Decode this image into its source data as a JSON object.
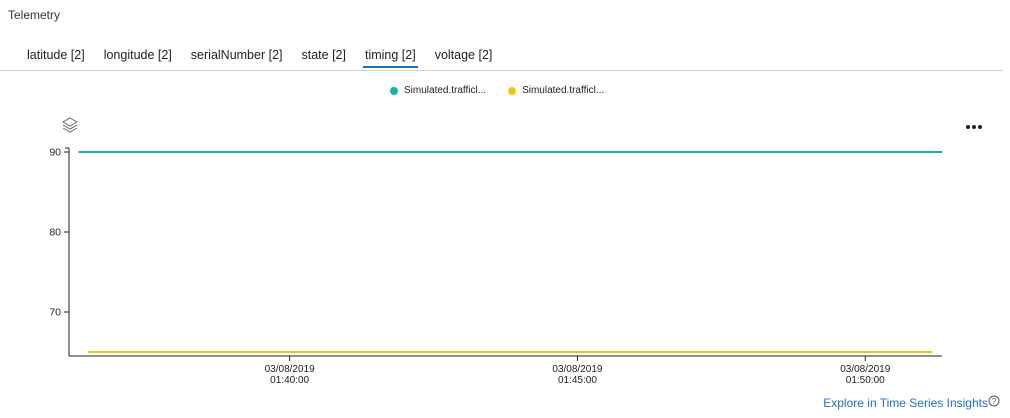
{
  "panel": {
    "title": "Telemetry"
  },
  "tabs": [
    {
      "label": "latitude [2]",
      "active": false
    },
    {
      "label": "longitude [2]",
      "active": false
    },
    {
      "label": "serialNumber [2]",
      "active": false
    },
    {
      "label": "state [2]",
      "active": false
    },
    {
      "label": "timing [2]",
      "active": true
    },
    {
      "label": "voltage [2]",
      "active": false
    }
  ],
  "legend": [
    {
      "label": "Simulated.trafficl...",
      "color": "#11b5a7"
    },
    {
      "label": "Simulated.trafficl...",
      "color": "#f2c40f"
    }
  ],
  "icons": {
    "layers": "layers-icon",
    "more": "more-options-icon",
    "info": "info-icon"
  },
  "footer": {
    "explore_label": "Explore in Time Series Insights"
  },
  "chart_data": {
    "type": "line",
    "title": "",
    "xlabel": "",
    "ylabel": "",
    "yticks": [
      70,
      80,
      90
    ],
    "ylim": [
      64.5,
      90.5
    ],
    "xlim": [
      "03/08/2019 01:36:10",
      "03/08/2019 01:51:20"
    ],
    "xticks": [
      {
        "value": "03/08/2019 01:40:00",
        "date": "03/08/2019",
        "time": "01:40:00"
      },
      {
        "value": "03/08/2019 01:45:00",
        "date": "03/08/2019",
        "time": "01:45:00"
      },
      {
        "value": "03/08/2019 01:50:00",
        "date": "03/08/2019",
        "time": "01:50:00"
      }
    ],
    "series": [
      {
        "name": "Simulated.trafficl...",
        "color": "#11b5a7",
        "x": [
          "03/08/2019 01:36:20",
          "03/08/2019 01:51:20"
        ],
        "y": [
          90,
          90
        ]
      },
      {
        "name": "Simulated.trafficl...",
        "color": "#f2c40f",
        "x": [
          "03/08/2019 01:36:30",
          "03/08/2019 01:51:10"
        ],
        "y": [
          65,
          65
        ]
      }
    ],
    "grid": false,
    "legend_position": "top-center"
  }
}
